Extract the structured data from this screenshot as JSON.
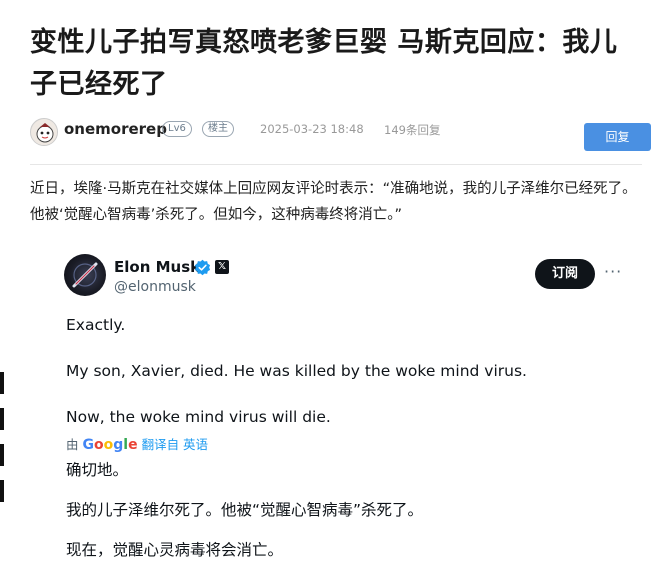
{
  "post": {
    "title": "变性儿子拍写真怒喷老爹巨婴 马斯克回应：我儿子已经死了",
    "author": "onemorerep",
    "level_badge": "Lv6",
    "floor_badge": "楼主",
    "date": "2025-03-23 18:48",
    "replies": "149条回复",
    "reply_button": "回复",
    "intro": "近日，埃隆·马斯克在社交媒体上回应网友评论时表示：“准确地说，我的儿子泽维尔已经死了。他被‘觉醒心智病毒’杀死了。但如今，这种病毒终将消亡。”"
  },
  "tweet": {
    "name": "Elon Musk",
    "handle": "@elonmusk",
    "follow_button": "订阅",
    "more": "···",
    "x_glyph": "𝕏",
    "line1": "Exactly.",
    "line2": "My son, Xavier, died. He was killed by the woke mind virus.",
    "line3": "Now, the woke mind virus will die.",
    "translate_by": "由",
    "translate_google": "Google",
    "translate_link": "翻译自 英语",
    "cn_line1": "确切地。",
    "cn_line2": "我的儿子泽维尔死了。他被“觉醒心智病毒”杀死了。",
    "cn_line3": "现在，觉醒心灵病毒将会消亡。"
  },
  "colors": {
    "reply_button": "#4a90e2",
    "verified": "#1d9bf0",
    "follow_button": "#0f1419",
    "translate_link": "#1d9bf0"
  },
  "icons": [
    "user-avatar-icon",
    "verified-badge-icon",
    "x-logo-icon",
    "more-options-icon",
    "elon-avatar-icon"
  ]
}
